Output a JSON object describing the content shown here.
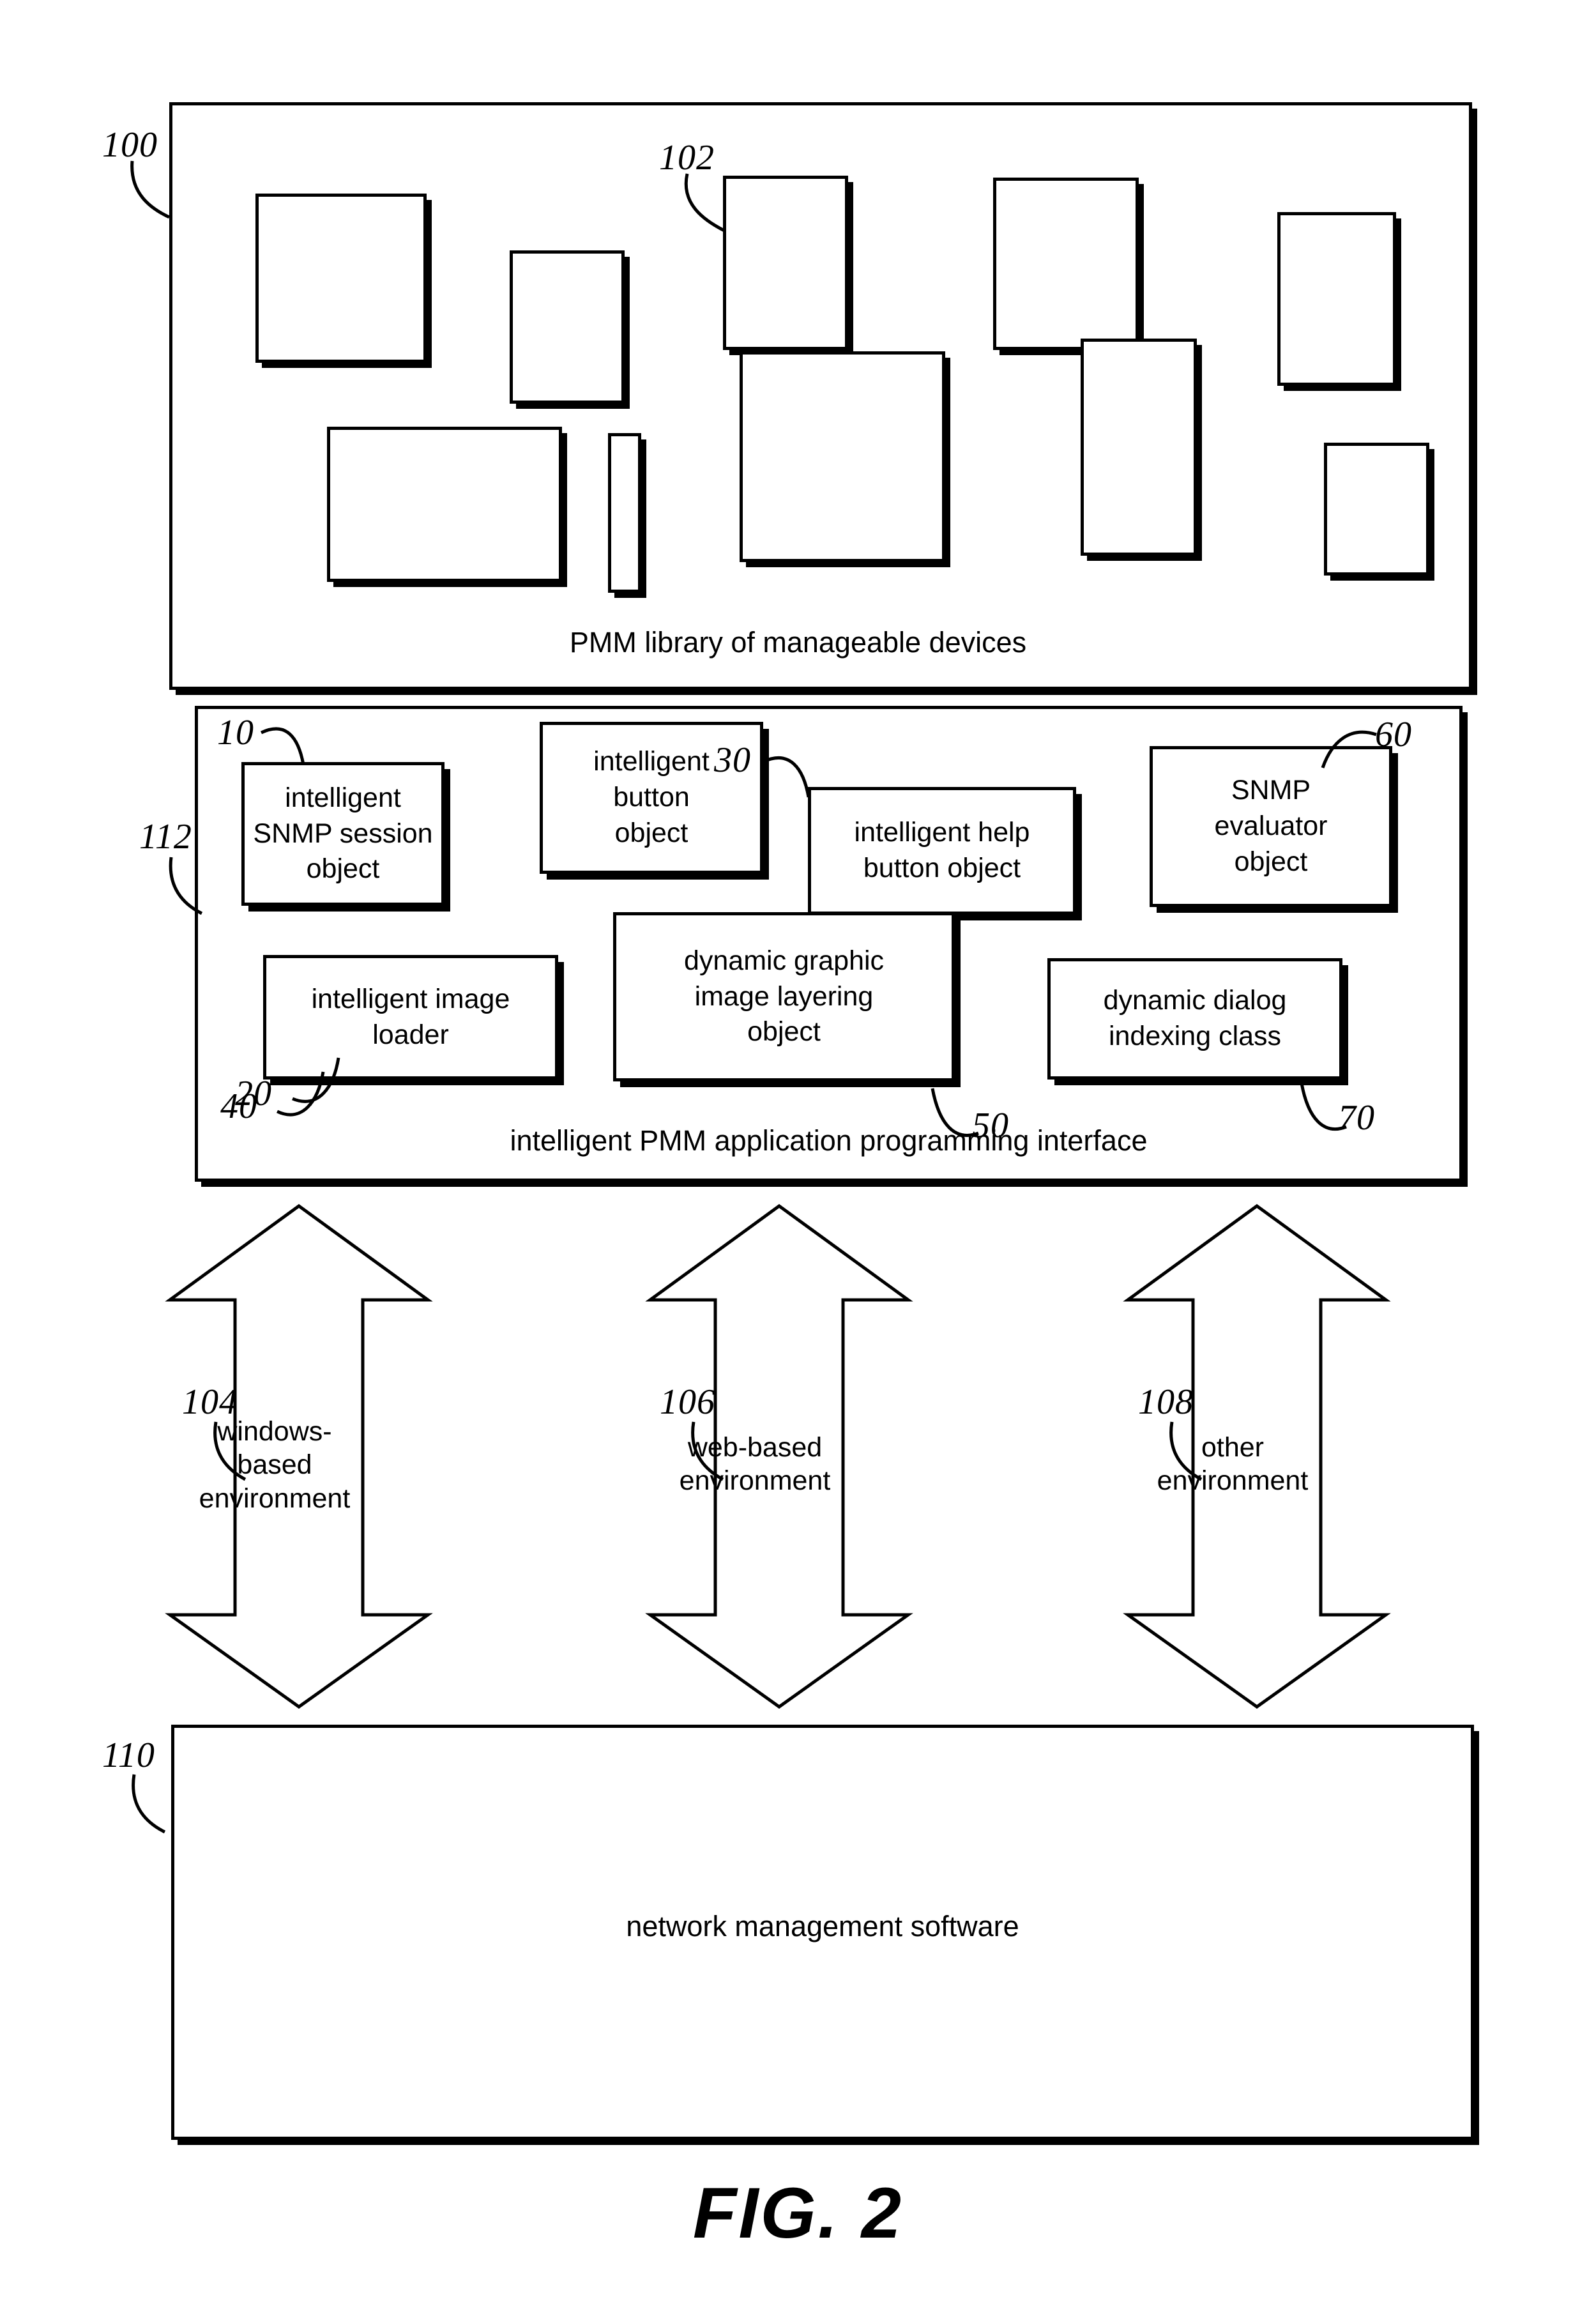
{
  "figure": {
    "title": "FIG. 2"
  },
  "library_panel": {
    "ref": "100",
    "caption": "PMM library of manageable devices",
    "device_ref": "102",
    "devices": [
      {
        "name": "device-1"
      },
      {
        "name": "device-2"
      },
      {
        "name": "device-3"
      },
      {
        "name": "device-4"
      },
      {
        "name": "device-5"
      },
      {
        "name": "device-6"
      },
      {
        "name": "device-7"
      },
      {
        "name": "device-8"
      },
      {
        "name": "device-9"
      },
      {
        "name": "device-10"
      }
    ]
  },
  "api_panel": {
    "ref": "112",
    "caption": "intelligent PMM application programming interface",
    "objects": [
      {
        "ref": "10",
        "label": "intelligent\nSNMP session\nobject",
        "name": "intelligent-snmp-session-object"
      },
      {
        "ref": "20",
        "label": "intelligent\nbutton\nobject",
        "name": "intelligent-button-object"
      },
      {
        "ref": "30",
        "label": "intelligent help\nbutton object",
        "name": "intelligent-help-button-object"
      },
      {
        "ref": "60",
        "label": "SNMP\nevaluator\nobject",
        "name": "snmp-evaluator-object"
      },
      {
        "ref": "40",
        "label": "intelligent image\nloader",
        "name": "intelligent-image-loader"
      },
      {
        "ref": "50",
        "label": "dynamic graphic\nimage layering\nobject",
        "name": "dynamic-graphic-image-layering-object"
      },
      {
        "ref": "70",
        "label": "dynamic dialog\nindexing class",
        "name": "dynamic-dialog-indexing-class"
      }
    ]
  },
  "environments": [
    {
      "ref": "104",
      "label": "windows-\nbased\nenvironment",
      "name": "windows-based-environment"
    },
    {
      "ref": "106",
      "label": "web-based\nenvironment",
      "name": "web-based-environment"
    },
    {
      "ref": "108",
      "label": "other\nenvironment",
      "name": "other-environment"
    }
  ],
  "nms_panel": {
    "ref": "110",
    "caption": "network management software"
  },
  "colors": {
    "ink": "#000000",
    "paper": "#ffffff"
  }
}
